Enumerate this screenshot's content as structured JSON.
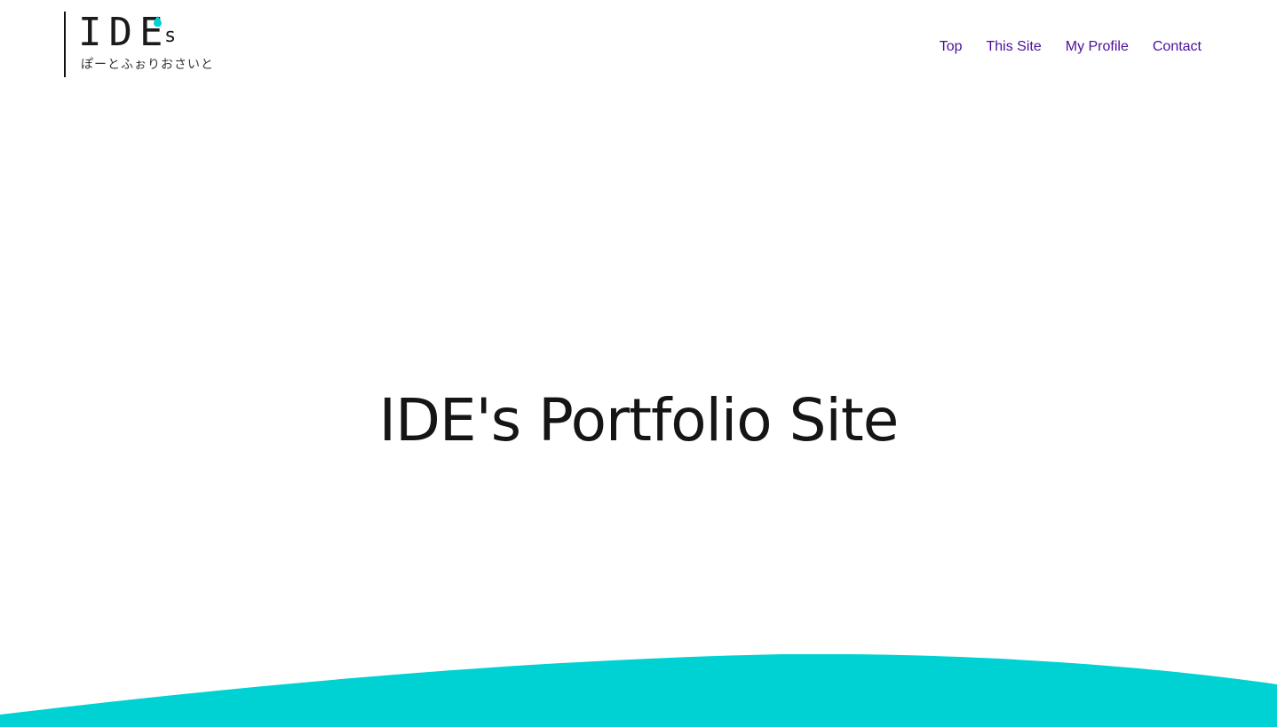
{
  "logo": {
    "mark": "IDE",
    "suffix": "s",
    "tagline": "ぽーとふぉりおさいと"
  },
  "nav": {
    "items": [
      {
        "label": "Top"
      },
      {
        "label": "This Site"
      },
      {
        "label": "My Profile"
      },
      {
        "label": "Contact"
      }
    ]
  },
  "hero": {
    "title": "IDE's Portfolio Site"
  },
  "colors": {
    "accent": "#00d2d3",
    "nav_link": "#4b0f9a",
    "text": "#151515",
    "background": "#ffffff"
  }
}
